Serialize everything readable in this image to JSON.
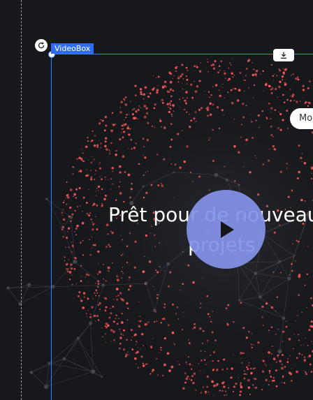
{
  "editor": {
    "selection_label": "VideoBox"
  },
  "video": {
    "title_line1": "Prêt pour de nouveaux",
    "title_line2": "projets",
    "more_button_label": "Mo"
  },
  "icons": {
    "rotate": "rotate-icon",
    "download": "download-icon",
    "play": "play-icon"
  },
  "colors": {
    "background": "#17181b",
    "particles": "#ff5a5a",
    "selection": "#3b82f6",
    "tag": "#2f6bf5",
    "play_button": "#8492e8"
  }
}
